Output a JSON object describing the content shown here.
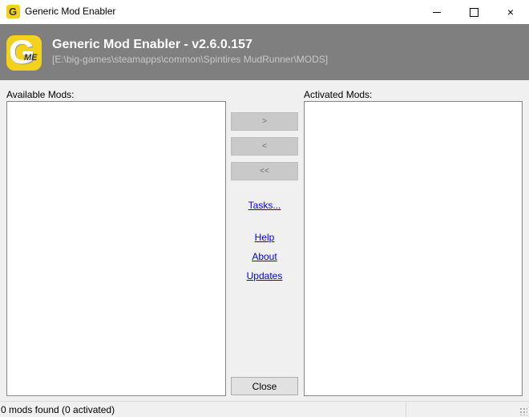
{
  "window": {
    "title": "Generic Mod Enabler",
    "icon": "gme-app-icon",
    "controls": {
      "minimize": "minimize-icon",
      "maximize": "maximize-icon",
      "close": "×"
    }
  },
  "header": {
    "logo_letter": "G",
    "logo_sub": "ME",
    "title": "Generic Mod Enabler - v2.6.0.157",
    "path": "[E:\\big-games\\steamapps\\common\\Spintires MudRunner\\MODS]"
  },
  "lists": {
    "available_label": "Available Mods:",
    "activated_label": "Activated Mods:"
  },
  "buttons": {
    "activate": ">",
    "deactivate": "<",
    "deactivate_all": "<<",
    "close": "Close"
  },
  "links": {
    "tasks": "Tasks...",
    "help": "Help",
    "about": "About",
    "updates": "Updates"
  },
  "status": {
    "text": "0 mods found (0 activated)"
  },
  "colors": {
    "header_bg": "#7f7f7f",
    "logo_yellow": "#f2d21a",
    "link": "#0000ee"
  }
}
